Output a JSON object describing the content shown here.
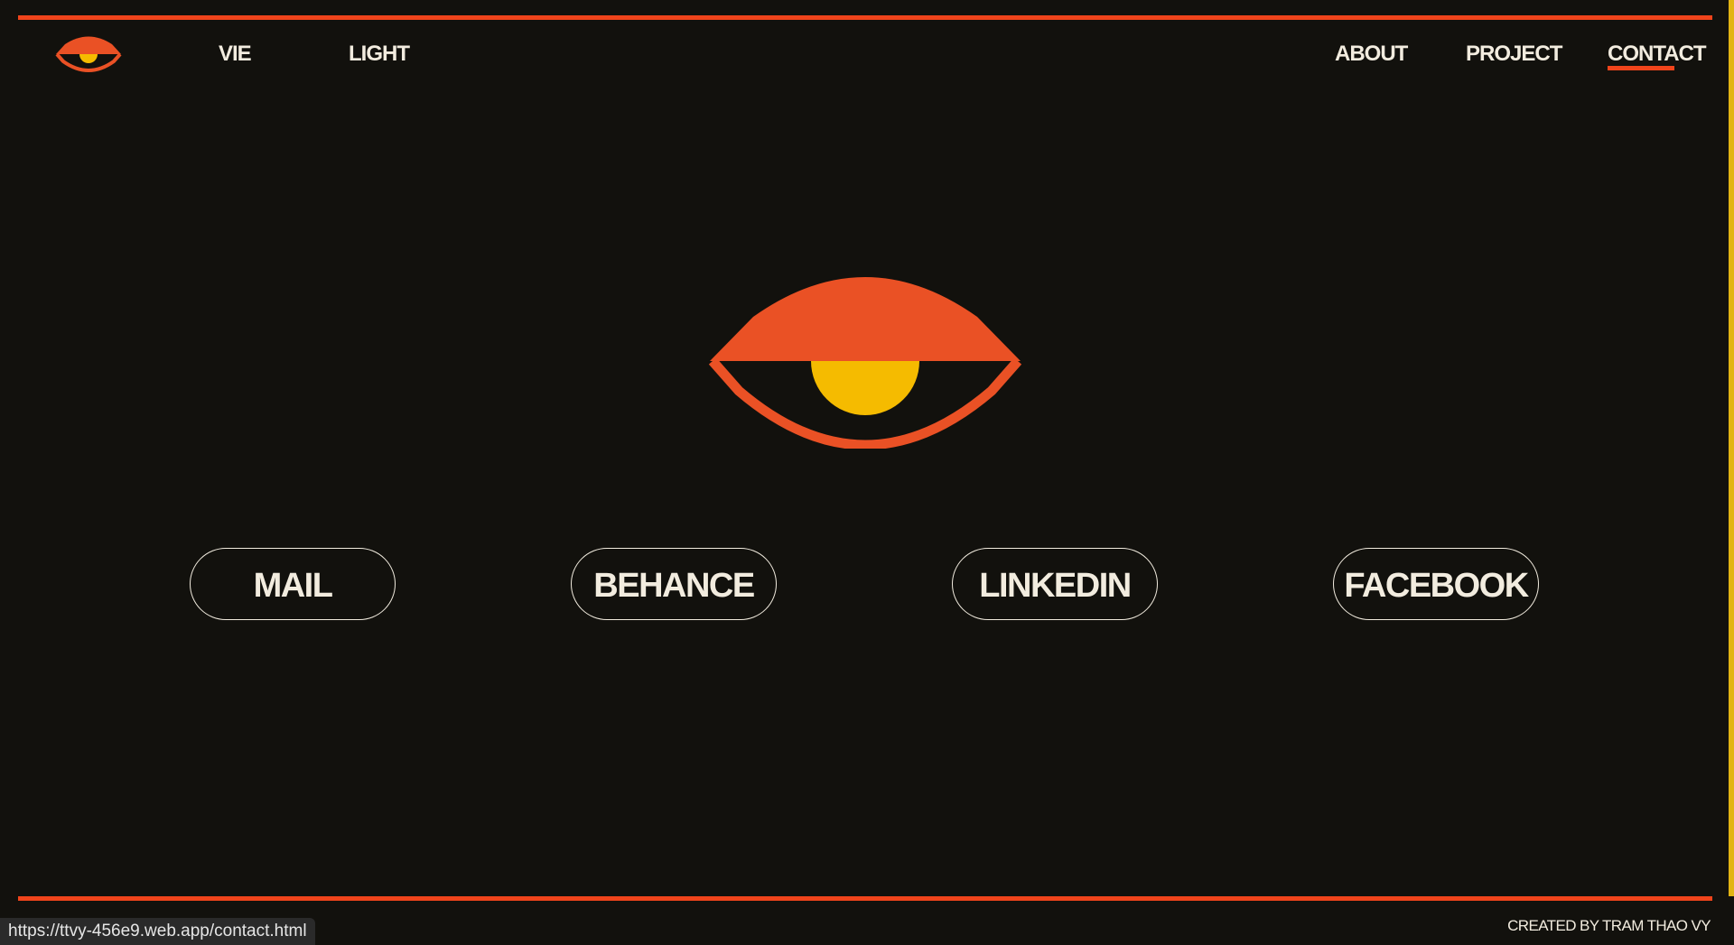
{
  "colors": {
    "background": "#12110d",
    "accent": "#f0441b",
    "eye_orange": "#ea5125",
    "pupil_yellow": "#f5bb00",
    "text": "#f2ecdf",
    "scrollbar": "#e2b414"
  },
  "header": {
    "logo_icon": "eye-logo-icon",
    "nav_left": [
      {
        "label": "VIE"
      },
      {
        "label": "LIGHT"
      }
    ],
    "nav_right": [
      {
        "label": "ABOUT"
      },
      {
        "label": "PROJECT"
      },
      {
        "label": "CONTACT",
        "active": true
      }
    ]
  },
  "hero": {
    "icon": "eye-icon"
  },
  "social_buttons": [
    {
      "label": "MAIL"
    },
    {
      "label": "BEHANCE"
    },
    {
      "label": "LINKEDIN"
    },
    {
      "label": "FACEBOOK"
    }
  ],
  "footer": {
    "credit": "CREATED BY TRAM THAO VY"
  },
  "browser": {
    "status_url": "https://ttvy-456e9.web.app/contact.html"
  }
}
